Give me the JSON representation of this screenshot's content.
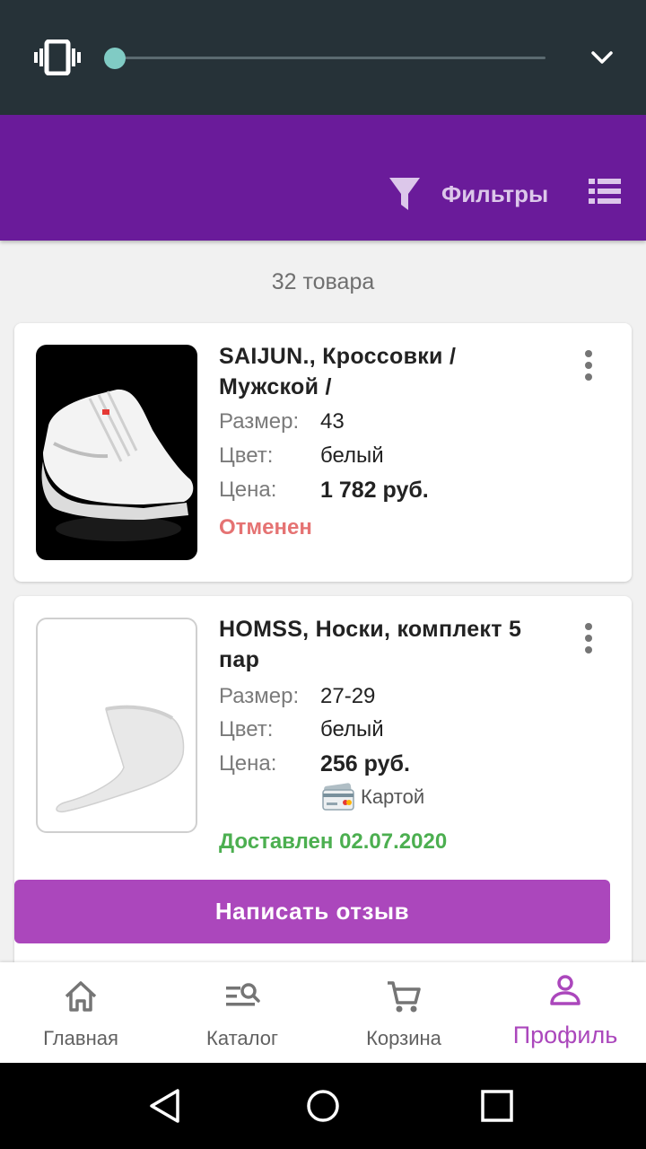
{
  "volume": {
    "level": 0.0,
    "icon": "vibrate-icon",
    "expand_icon": "chevron-down-icon"
  },
  "header": {
    "filter_label": "Фильтры",
    "filter_icon": "filter-icon",
    "view_icon": "list-view-icon"
  },
  "results": {
    "count_text": "32 товара"
  },
  "orders": [
    {
      "title": "SAIJUN., Кроссовки  / Мужской /",
      "image": "sneaker-image",
      "size_label": "Размер:",
      "size": "43",
      "color_label": "Цвет:",
      "color": "белый",
      "price_label": "Цена:",
      "price": "1 782 руб.",
      "status": "Отменен"
    },
    {
      "title": "HOMSS, Носки, комплект 5 пар",
      "image": "sock-image",
      "size_label": "Размер:",
      "size": "27-29",
      "color_label": "Цвет:",
      "color": "белый",
      "price_label": "Цена:",
      "price": "256 руб.",
      "payment": "Картой",
      "status": "Доставлен 02.07.2020",
      "review_button": "Написать отзыв"
    }
  ],
  "bottom_nav": [
    {
      "label": "Главная",
      "icon": "home-icon",
      "active": false
    },
    {
      "label": "Каталог",
      "icon": "catalog-search-icon",
      "active": false
    },
    {
      "label": "Корзина",
      "icon": "cart-icon",
      "active": false
    },
    {
      "label": "Профиль",
      "icon": "profile-icon",
      "active": true
    }
  ],
  "colors": {
    "header": "#6a1b9a",
    "accent": "#ab47bc",
    "cancelled": "#e57373",
    "delivered": "#4caf50"
  }
}
